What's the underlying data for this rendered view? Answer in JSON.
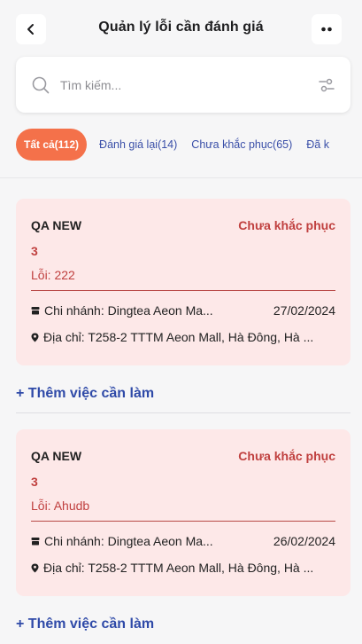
{
  "header": {
    "title": "Quản lý lỗi cần đánh giá",
    "back_icon": "chevron-left-icon",
    "more_icon": "more-dots-icon"
  },
  "search": {
    "placeholder": "Tìm kiếm...",
    "search_icon": "search-icon",
    "filter_icon": "filter-icon"
  },
  "tabs": [
    {
      "label": "Tất cả(112)",
      "active": true
    },
    {
      "label": "Đánh giá lại(14)",
      "active": false
    },
    {
      "label": "Chưa khắc phục(65)",
      "active": false
    },
    {
      "label": "Đã k",
      "active": false
    }
  ],
  "cards": [
    {
      "name": "QA NEW",
      "status": "Chưa khắc phục",
      "count": "3",
      "error": "Lỗi: 222",
      "branch": "Chi nhánh: Dingtea Aeon Ma...",
      "date": "27/02/2024",
      "address": "Địa chỉ: T258-2 TTTM Aeon Mall, Hà Đông, Hà ..."
    },
    {
      "name": "QA NEW",
      "status": "Chưa khắc phục",
      "count": "3",
      "error": "Lỗi: Ahudb",
      "branch": "Chi nhánh: Dingtea Aeon Ma...",
      "date": "26/02/2024",
      "address": "Địa chỉ: T258-2 TTTM Aeon Mall, Hà Đông, Hà ..."
    }
  ],
  "add_task_label": "+ Thêm việc cần làm",
  "colors": {
    "accent": "#f4714a",
    "card_bg": "#fde8e8",
    "status_red": "#c0403f",
    "link_blue": "#2f4aa8"
  }
}
